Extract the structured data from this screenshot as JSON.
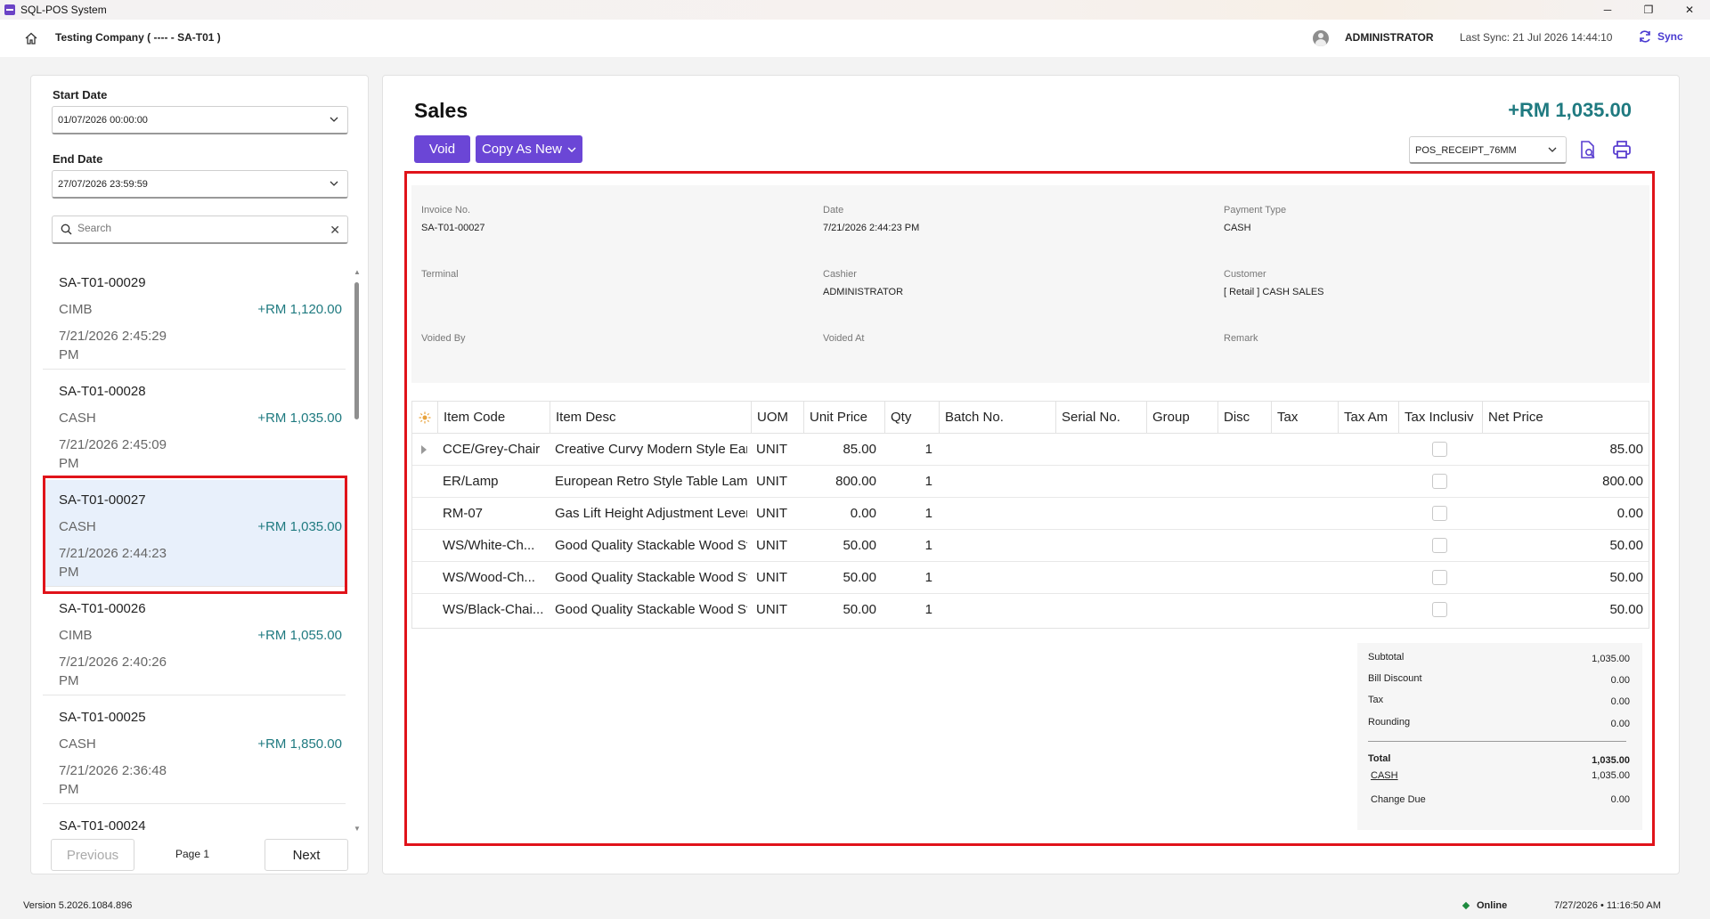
{
  "window": {
    "title": "SQL-POS System",
    "minimize": "─",
    "restore": "❐",
    "close": "✕"
  },
  "header": {
    "company": "Testing Company ( ---- - SA-T01 )",
    "user": "ADMINISTRATOR",
    "last_sync": "Last Sync: 21 Jul 2026 14:44:10",
    "sync_label": "Sync"
  },
  "filters": {
    "start_date_label": "Start Date",
    "start_date_value": "01/07/2026 00:00:00",
    "end_date_label": "End Date",
    "end_date_value": "27/07/2026 23:59:59",
    "search_placeholder": "Search"
  },
  "invoices": [
    {
      "invoice": "SA-T01-00029",
      "type": "CIMB",
      "amount": "+RM 1,120.00",
      "date": "7/21/2026 2:45:29 PM"
    },
    {
      "invoice": "SA-T01-00028",
      "type": "CASH",
      "amount": "+RM 1,035.00",
      "date": "7/21/2026 2:45:09 PM"
    },
    {
      "invoice": "SA-T01-00027",
      "type": "CASH",
      "amount": "+RM 1,035.00",
      "date": "7/21/2026 2:44:23 PM"
    },
    {
      "invoice": "SA-T01-00026",
      "type": "CIMB",
      "amount": "+RM 1,055.00",
      "date": "7/21/2026 2:40:26 PM"
    },
    {
      "invoice": "SA-T01-00025",
      "type": "CASH",
      "amount": "+RM 1,850.00",
      "date": "7/21/2026 2:36:48 PM"
    },
    {
      "invoice": "SA-T01-00024",
      "type": "",
      "amount": "",
      "date": ""
    }
  ],
  "pager": {
    "previous": "Previous",
    "page": "Page 1",
    "next": "Next"
  },
  "sales": {
    "title": "Sales",
    "total": "+RM 1,035.00",
    "void_label": "Void",
    "copy_label": "Copy As New",
    "receipt_template": "POS_RECEIPT_76MM"
  },
  "info": {
    "invoice_no_label": "Invoice No.",
    "invoice_no": "SA-T01-00027",
    "date_label": "Date",
    "date": "7/21/2026 2:44:23 PM",
    "payment_type_label": "Payment Type",
    "payment_type": "CASH",
    "terminal_label": "Terminal",
    "terminal": "",
    "cashier_label": "Cashier",
    "cashier": "ADMINISTRATOR",
    "customer_label": "Customer",
    "customer": "[ Retail ] CASH SALES",
    "voided_by_label": "Voided By",
    "voided_at_label": "Voided At",
    "remark_label": "Remark"
  },
  "grid": {
    "columns": [
      "Item Code",
      "Item Desc",
      "UOM",
      "Unit Price",
      "Qty",
      "Batch No.",
      "Serial No.",
      "Group",
      "Disc",
      "Tax",
      "Tax Am",
      "Tax Inclusiv",
      "Net Price"
    ],
    "rows": [
      {
        "code": "CCE/Grey-Chair",
        "desc": "Creative Curvy Modern Style Eames ...",
        "uom": "UNIT",
        "price": "85.00",
        "qty": "1",
        "net": "85.00"
      },
      {
        "code": "ER/Lamp",
        "desc": "European Retro Style Table Lamp",
        "uom": "UNIT",
        "price": "800.00",
        "qty": "1",
        "net": "800.00"
      },
      {
        "code": "RM-07",
        "desc": "Gas Lift Height Adjustment Lever",
        "uom": "UNIT",
        "price": "0.00",
        "qty": "1",
        "net": "0.00"
      },
      {
        "code": "WS/White-Ch...",
        "desc": "Good Quality Stackable Wood Stool ...",
        "uom": "UNIT",
        "price": "50.00",
        "qty": "1",
        "net": "50.00"
      },
      {
        "code": "WS/Wood-Ch...",
        "desc": "Good Quality Stackable Wood Stool ...",
        "uom": "UNIT",
        "price": "50.00",
        "qty": "1",
        "net": "50.00"
      },
      {
        "code": "WS/Black-Chai...",
        "desc": "Good Quality Stackable Wood Stool ...",
        "uom": "UNIT",
        "price": "50.00",
        "qty": "1",
        "net": "50.00"
      }
    ]
  },
  "summary": {
    "subtotal_label": "Subtotal",
    "subtotal": "1,035.00",
    "bill_discount_label": "Bill Discount",
    "bill_discount": "0.00",
    "tax_label": "Tax",
    "tax": "0.00",
    "rounding_label": "Rounding",
    "rounding": "0.00",
    "total_label": "Total",
    "total": "1,035.00",
    "cash_label": "CASH",
    "cash": "1,035.00",
    "change_due_label": "Change Due",
    "change_due": "0.00"
  },
  "status": {
    "version": "Version 5.2026.1084.896",
    "online": "Online",
    "datetime": "7/27/2026  •  11:16:50 AM"
  },
  "colors": {
    "accent": "#6b46d6",
    "amount": "#1f7a80",
    "highlight_border": "#e0131a",
    "selected_row": "#e8f0fb"
  }
}
